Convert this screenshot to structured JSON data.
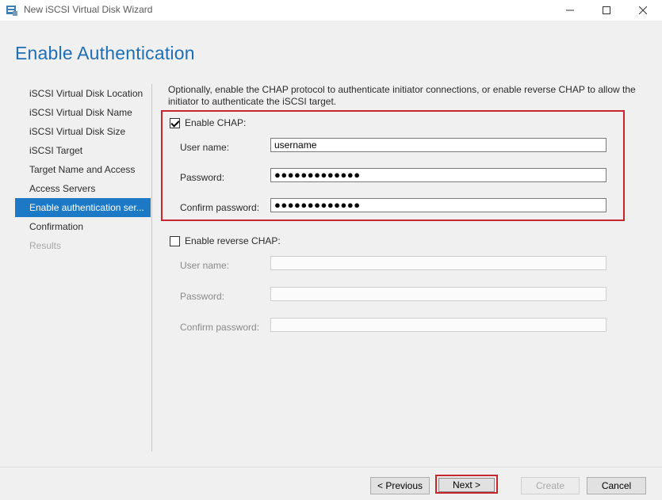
{
  "window": {
    "title": "New iSCSI Virtual Disk Wizard",
    "controls": {
      "minimize": "minimize-icon",
      "maximize": "maximize-icon",
      "close": "close-icon"
    }
  },
  "page": {
    "heading": "Enable Authentication"
  },
  "nav": {
    "items": [
      {
        "label": "iSCSI Virtual Disk Location",
        "state": "normal"
      },
      {
        "label": "iSCSI Virtual Disk Name",
        "state": "normal"
      },
      {
        "label": "iSCSI Virtual Disk Size",
        "state": "normal"
      },
      {
        "label": "iSCSI Target",
        "state": "normal"
      },
      {
        "label": "Target Name and Access",
        "state": "normal"
      },
      {
        "label": "Access Servers",
        "state": "normal"
      },
      {
        "label": "Enable authentication ser...",
        "state": "active"
      },
      {
        "label": "Confirmation",
        "state": "normal"
      },
      {
        "label": "Results",
        "state": "disabled"
      }
    ]
  },
  "main": {
    "description": "Optionally, enable the CHAP protocol to authenticate initiator connections, or enable reverse CHAP to allow the initiator to authenticate the iSCSI target.",
    "chap": {
      "checkbox_label": "Enable CHAP:",
      "checked": true,
      "username_label": "User name:",
      "username_value": "username",
      "password_label": "Password:",
      "password_value": "●●●●●●●●●●●●●",
      "confirm_label": "Confirm password:",
      "confirm_value": "●●●●●●●●●●●●●"
    },
    "reverse_chap": {
      "checkbox_label": "Enable reverse CHAP:",
      "checked": false,
      "username_label": "User name:",
      "password_label": "Password:",
      "confirm_label": "Confirm password:"
    }
  },
  "footer": {
    "previous": "< Previous",
    "next": "Next >",
    "create": "Create",
    "cancel": "Cancel"
  },
  "colors": {
    "accent": "#1c79c6",
    "heading": "#1f6fb5",
    "highlight": "#c7262e"
  }
}
